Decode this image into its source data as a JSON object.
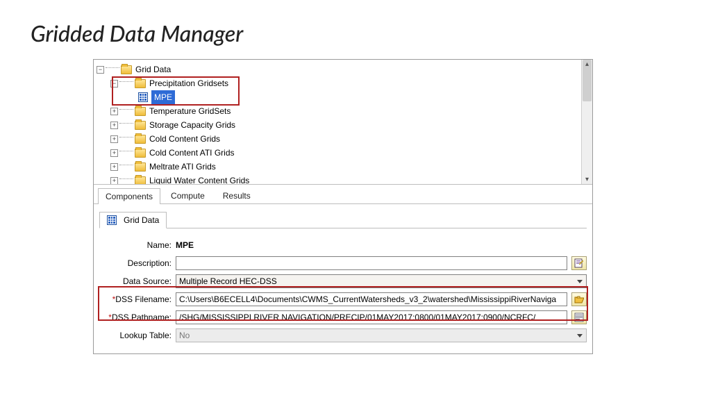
{
  "slide_title": "Gridded Data Manager",
  "tree": {
    "root": "Grid Data",
    "nodes": [
      {
        "label": "Precipitation Gridsets",
        "expanded": true,
        "children": [
          {
            "label": "MPE",
            "selected": true
          }
        ]
      },
      {
        "label": "Temperature GridSets"
      },
      {
        "label": "Storage Capacity Grids"
      },
      {
        "label": "Cold Content Grids"
      },
      {
        "label": "Cold Content ATI Grids"
      },
      {
        "label": "Meltrate ATI Grids"
      },
      {
        "label": "Liquid Water Content Grids"
      }
    ]
  },
  "tabs": {
    "items": [
      "Components",
      "Compute",
      "Results"
    ],
    "active": "Components"
  },
  "detail": {
    "tab_label": "Grid Data",
    "name_label": "Name:",
    "name_value": "MPE",
    "description_label": "Description:",
    "description_value": "",
    "datasource_label": "Data Source:",
    "datasource_value": "Multiple Record HEC-DSS",
    "dssfile_label": "*DSS Filename:",
    "dssfile_value": "C:\\Users\\B6ECELL4\\Documents\\CWMS_CurrentWatersheds_v3_2\\watershed\\MississippiRiverNaviga",
    "dsspath_label": "*DSS Pathname:",
    "dsspath_value": "/SHG/MISSISSIPPI RIVER NAVIGATION/PRECIP/01MAY2017:0800/01MAY2017:0900/NCRFC/",
    "lookup_label": "Lookup Table:",
    "lookup_value": "No"
  }
}
